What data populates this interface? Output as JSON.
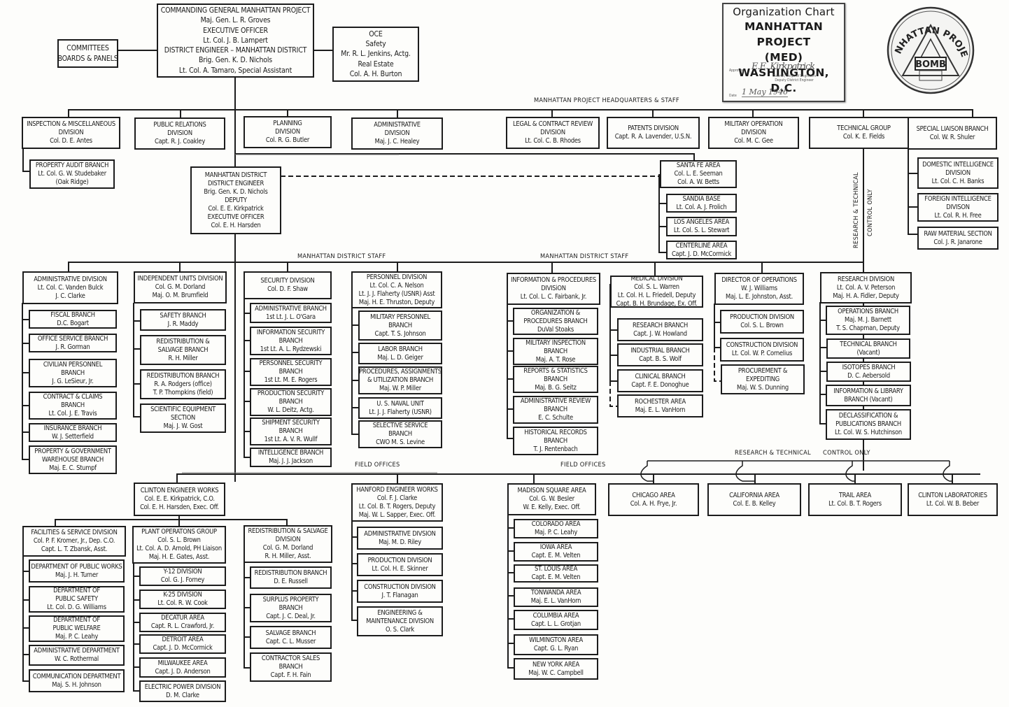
{
  "title_block": {
    "line1": "Organization Chart",
    "line2": "MANHATTAN PROJECT",
    "line3": "(MED)",
    "line4": "WASHINGTON, D.C.",
    "approved_label": "Approved",
    "signature": "E.E. Kirkpatrick",
    "signature_title": [
      "Colonel, Corps of Engineers",
      "Deputy District Engineer"
    ],
    "date_label": "Date",
    "date": "1 May 1946"
  },
  "seal": {
    "top_text": "MANHATTAN PROJECT",
    "center_text": "BOMB",
    "icon": "a-bomb-seal-icon"
  },
  "section_labels": {
    "hq_staff": "MANHATTAN PROJECT  HEADQUARTERS & STAFF",
    "district_staff_left": "MANHATTAN  DISTRICT STAFF",
    "district_staff_right": "MANHATTAN  DISTRICT STAFF",
    "field_offices_left": "FIELD  OFFICES",
    "field_offices_right": "FIELD  OFFICES",
    "rt_control_vertical_1": "RESEARCH & TECHNICAL",
    "rt_control_vertical_2": "CONTROL ONLY",
    "rt_control_horizontal_1": "RESEARCH & TECHNICAL",
    "rt_control_horizontal_2": "CONTROL ONLY"
  },
  "nodes": {
    "commanding_general": [
      "COMMANDING GENERAL MANHATTAN PROJECT",
      "Maj. Gen. L. R. Groves",
      "EXECUTIVE OFFICER",
      "Lt. Col. J. B. Lampert",
      "DISTRICT ENGINEER – MANHATTAN DISTRICT",
      "Brig. Gen. K. D. Nichols",
      "Lt. Col. A. Tamaro, Special Assistant"
    ],
    "committees": [
      "COMMITTEES",
      "BOARDS & PANELS"
    ],
    "oce": [
      "OCE",
      "Safety",
      "Mr. R. L. Jenkins, Actg.",
      "Real Estate",
      "Col. A. H. Burton"
    ],
    "inspection": [
      "INSPECTION & MISCELLANEOUS",
      "DIVISION",
      "Col. D. E. Antes"
    ],
    "property_audit": [
      "PROPERTY AUDIT BRANCH",
      "Lt. Col. G. W. Studebaker",
      "(Oak Ridge)"
    ],
    "public_relations": [
      "PUBLIC RELATIONS",
      "DIVISION",
      "Capt. R. J. Coakley"
    ],
    "planning": [
      "PLANNING",
      "DIVISION",
      "Col. R. G. Butler"
    ],
    "hq_administrative": [
      "ADMINISTRATIVE",
      "DIVISION",
      "Maj. J. C. Healey"
    ],
    "legal": [
      "LEGAL & CONTRACT REVIEW",
      "DIVISION",
      "Lt. Col. C. B. Rhodes"
    ],
    "patents": [
      "PATENTS DIVISION",
      "Capt. R. A. Lavender, U.S.N."
    ],
    "military_operation": [
      "MILITARY OPERATION",
      "DIVISION",
      "Col. M. C. Gee"
    ],
    "technical_group": [
      "TECHNICAL GROUP",
      "Col. K. E. Fields"
    ],
    "special_liaison": [
      "SPECIAL LIAISON BRANCH",
      "Col. W. R. Shuler"
    ],
    "domestic_intel": [
      "DOMESTIC INTELLIGENCE",
      "DIVISION",
      "Lt. Col. C. H. Banks"
    ],
    "foreign_intel": [
      "FOREIGN INTELLIGENCE",
      "DIVISON",
      "Lt. Col. R. H. Free"
    ],
    "raw_material": [
      "RAW MATERIAL SECTION",
      "Col. J. R. Janarone"
    ],
    "district_engineer": [
      "MANHATTAN DISTRICT",
      "DISTRICT ENGINEER",
      "Brig. Gen. K. D. Nichols",
      "DEPUTY",
      "Col. E. E. Kirkpatrick",
      "EXECUTIVE OFFICER",
      "Col. E. H. Harsden"
    ],
    "santa_fe": [
      "SANTA FE AREA",
      "Col. L. E. Seeman",
      "Col. A. W. Betts"
    ],
    "sandia": [
      "SANDIA BASE",
      "Lt. Col. A. J. Frolich"
    ],
    "los_angeles": [
      "LOS ANGELES AREA",
      "Lt. Col. S. L. Stewart"
    ],
    "centerline": [
      "CENTERLINE AREA",
      "Capt. J. D. McCormick"
    ],
    "md_admin": [
      "ADMINISTRATIVE DIVISION",
      "Lt. Col. C. Vanden Bulck",
      "J. C. Clarke"
    ],
    "fiscal": [
      "FISCAL BRANCH",
      "D.C. Bogart"
    ],
    "office_service": [
      "OFFICE SERVICE BRANCH",
      "J. R. Gorman"
    ],
    "civilian_personnel": [
      "CIVILIAN PERSONNEL",
      "BRANCH",
      "J. G. LeSieur, Jr."
    ],
    "contract_claims": [
      "CONTRACT & CLAIMS",
      "BRANCH",
      "Lt. Col. J. E. Travis"
    ],
    "insurance": [
      "INSURANCE BRANCH",
      "W. J. Setterfield"
    ],
    "property_gov": [
      "PROPERTY & GOVERNMENT",
      "WAREHOUSE BRANCH",
      "Maj. E. C. Stumpf"
    ],
    "independent_units": [
      "INDEPENDENT UNITS DIVISION",
      "Col. G. M. Dorland",
      "Maj. O. M. Brumfield"
    ],
    "safety_branch": [
      "SAFETY BRANCH",
      "J. R. Maddy"
    ],
    "redist_salvage_branch": [
      "REDISTRIBUTION &",
      "SALVAGE BRANCH",
      "R. H. Miller"
    ],
    "redist_branch_iu": [
      "REDISTRIBUTION BRANCH",
      "R. A. Rodgers (office)",
      "T. P. Thompkins (field)"
    ],
    "sci_equipment": [
      "SCIENTIFIC EQUIPMENT",
      "SECTION",
      "Maj. J. W. Gost"
    ],
    "security": [
      "SECURITY DIVISION",
      "Col. D. F. Shaw"
    ],
    "sec_admin": [
      "ADMINISTRATIVE BRANCH",
      "1st Lt. J. L. O'Gara"
    ],
    "info_security": [
      "INFORMATION SECURITY",
      "BRANCH",
      "1st Lt. A. L. Rydzewski"
    ],
    "personnel_security": [
      "PERSONNEL SECURITY",
      "BRANCH",
      "1st Lt. M. E. Rogers"
    ],
    "production_security": [
      "PRODUCTION SECURITY",
      "BRANCH",
      "W. L. Deitz, Actg."
    ],
    "shipment_security": [
      "SHIPMENT SECURITY",
      "BRANCH",
      "1st Lt. A. V. R. Wullf"
    ],
    "intelligence": [
      "INTELLIGENCE BRANCH",
      "Maj. J. J. Jackson"
    ],
    "personnel": [
      "PERSONNEL DIVISION",
      "Lt. Col. C. A. Nelson",
      "Lt. J. J. Flaherty (USNR) Asst",
      "Maj. H. E. Thruston, Deputy"
    ],
    "military_personnel": [
      "MILITARY PERSONNEL",
      "BRANCH",
      "Capt. T. S. Johnson"
    ],
    "labor": [
      "LABOR BRANCH",
      "Maj. L. D. Geiger"
    ],
    "procedures_assign": [
      "PROCEDURES, ASSIGNMENTS",
      "& UTILIZATION BRANCH",
      "Maj. W. P. Miller"
    ],
    "naval_unit": [
      "U. S. NAVAL UNIT",
      "Lt. J. J. Flaherty (USNR)"
    ],
    "selective_service": [
      "SELECTIVE SERVICE",
      "BRANCH",
      "CWO M. S. Levine"
    ],
    "info_procedures": [
      "INFORMATION & PROCEDURES",
      "DIVISiON",
      "Lt. Col. L. C. Fairbank, Jr."
    ],
    "org_procedures": [
      "ORGANIZATION &",
      "PROCEDURES BRANCH",
      "DuVal Stoaks"
    ],
    "military_inspection": [
      "MILITARY INSPECTION",
      "BRANCH",
      "Maj. A. T. Rose"
    ],
    "reports_stats": [
      "REPORTS & STATISTICS",
      "BRANCH",
      "Maj. B. G. Seitz"
    ],
    "admin_review": [
      "ADMINISTRATIVE REVIEW",
      "BRANCH",
      "E. C. Schulte"
    ],
    "historical": [
      "HISTORICAL RECORDS",
      "BRANCH",
      "T. J. Rentenbach"
    ],
    "medical": [
      "MEDICAL DIVISION",
      "Col. S. L. Warren",
      "Lt. Col. H. L. Friedell, Deputy",
      "Capt. B. H. Brundage, Ex. Off."
    ],
    "research_branch": [
      "RESEARCH BRANCH",
      "Capt. J. W. Howland"
    ],
    "industrial": [
      "INDUSTRIAL BRANCH",
      "Capt. B. S. Wolf"
    ],
    "clinical": [
      "CLINICAL BRANCH",
      "Capt. F. E. Donoghue"
    ],
    "rochester": [
      "ROCHESTER AREA",
      "Maj. E. L. VanHorn"
    ],
    "dir_operations": [
      "DIRECTOR OF OPERATIONS",
      "W. J. Williams",
      "Maj. L. E. Johnston, Asst."
    ],
    "production_div": [
      "PRODUCTION DIVISION",
      "Col. S. L. Brown"
    ],
    "construction_div": [
      "CONSTRUCTION DIVISION",
      "Lt. Col. W. P. Cornelius"
    ],
    "procurement": [
      "PROCUREMENT &",
      "EXPEDITING",
      "Maj. W. S. Dunning"
    ],
    "research_div": [
      "RESEARCH DIVISION",
      "Lt. Col. A. V. Peterson",
      "Maj. H. A. Fidler, Deputy"
    ],
    "operations_branch": [
      "OPERATIONS BRANCH",
      "Maj. M. J. Barnett",
      "T. S. Chapman, Deputy"
    ],
    "technical_branch": [
      "TECHNICAL BRANCH",
      "(Vacant)"
    ],
    "isotopes": [
      "ISOTOPES BRANCH",
      "D. C. Aebersold"
    ],
    "info_library": [
      "INFORMATION & LIBRARY",
      "BRANCH (Vacant)"
    ],
    "declassification": [
      "DECLASSIFICATION &",
      "PUBLICATIONS BRANCH",
      "Lt. Col. W. S. Hutchinson"
    ],
    "clinton_works": [
      "CLINTON ENGINEER WORKS",
      "Col. E. E. Kirkpatrick, C.O.",
      "Col. E. H. Harsden, Exec. Off."
    ],
    "facilities": [
      "FACILITIES & SERVICE DIVISION",
      "Col. P. F. Kromer, Jr., Dep. C.O.",
      "Capt. L. T. Zbansk, Asst."
    ],
    "public_works": [
      "DEPARTMENT OF PUBLIC WORKS",
      "Maj. J. H. Turner"
    ],
    "public_safety": [
      "DEPARTMENT OF",
      "PUBLIC SAFETY",
      "Lt. Col. D. G. Williams"
    ],
    "public_welfare": [
      "DEPARTMENT OF",
      "PUBLIC WELFARE",
      "Maj. P. C. Leahy"
    ],
    "admin_dept": [
      "ADMINISTRATIVE DEPARTMENT",
      "W. C. Rothermal"
    ],
    "communication": [
      "COMMUNICATION DEPARTMENT",
      "Maj. S. H. Johnson"
    ],
    "plant_ops": [
      "PLANT OPERATONS GROUP",
      "Col. S. L. Brown",
      "Lt. Col. A. D. Arnold, PH Liaison",
      "Maj. H. E. Gates, Asst."
    ],
    "y12": [
      "Y-12 DIVISION",
      "Col. G. J. Forney"
    ],
    "k25": [
      "K-25 DIVISION",
      "Lt. Col. R. W. Cook"
    ],
    "decatur": [
      "DECATUR AREA",
      "Capt. R. L. Crawford, Jr."
    ],
    "detroit": [
      "DETROIT AREA",
      "Capt. J. D. McCormick"
    ],
    "milwaukee": [
      "MILWAUKEE AREA",
      "Capt. J. D. Anderson"
    ],
    "electric_power": [
      "ELECTRIC POWER DIVISION",
      "D. M. Clarke"
    ],
    "redist_salvage_div": [
      "REDISTRIBUTION & SALVAGE",
      "DIVISION",
      "Col. G. M. Dorland",
      "R. H. Miller, Asst."
    ],
    "redist_branch_cew": [
      "REDISTRIBUTION BRANCH",
      "D. E. Russell"
    ],
    "surplus": [
      "SURPLUS PROPERTY",
      "BRANCH",
      "Capt. J. C. Deal, Jr."
    ],
    "salvage": [
      "SALVAGE BRANCH",
      "Capt. C. L. Musser"
    ],
    "contractor_sales": [
      "CONTRACTOR SALES",
      "BRANCH",
      "Capt. F. H. Fain"
    ],
    "hanford": [
      "HANFORD ENGINEER WORKS",
      "Col. F. J. Clarke",
      "Lt. Col. B. T. Rogers, Deputy",
      "Maj. W. L. Sapper, Exec. Off."
    ],
    "hanford_admin": [
      "ADMINISTRATIVE DIVSION",
      "Maj. M. D. Riley"
    ],
    "hanford_production": [
      "PRODUCTION DIVISION",
      "Lt. Col. H. E. Skinner"
    ],
    "hanford_construction": [
      "CONSTRUCTION DIVISION",
      "J. T. Flanagan"
    ],
    "hanford_engineering": [
      "ENGINEERING &",
      "MAINTENANCE DIVISION",
      "O. S. Clark"
    ],
    "madison_square": [
      "MADISON SQUARE AREA",
      "Col. G. W. Besler",
      "W. E. Kelly, Exec. Off."
    ],
    "colorado": [
      "COLORADO AREA",
      "Maj. P. C. Leahy"
    ],
    "iowa": [
      "IOWA AREA",
      "Capt. E. M. Velten"
    ],
    "st_louis": [
      "ST. LOUIS AREA",
      "Capt. E. M. Velten"
    ],
    "tonwanda": [
      "TONWANDA AREA",
      "Maj. E. L. VanHorn"
    ],
    "columbia": [
      "COLUMBIA AREA",
      "Capt. L. L. Grotjan"
    ],
    "wilmington": [
      "WILMINGTON AREA",
      "Capt. G. L. Ryan"
    ],
    "new_york": [
      "NEW YORK AREA",
      "Maj. W. C. Campbell"
    ],
    "chicago": [
      "CHICAGO AREA",
      "Col. A. H. Frye, Jr."
    ],
    "california": [
      "CALIFORNIA AREA",
      "Col. E. B. Kelley"
    ],
    "trail": [
      "TRAIL AREA",
      "Lt. Col. B. T. Rogers"
    ],
    "clinton_labs": [
      "CLINTON LABORATORIES",
      "Lt. Col. W. B. Beber"
    ]
  }
}
